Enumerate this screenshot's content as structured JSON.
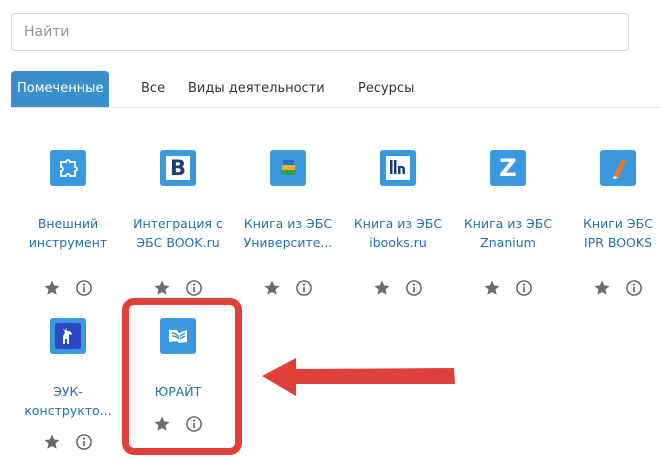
{
  "search": {
    "placeholder": "Найти"
  },
  "tabs": [
    {
      "label": "Помеченные"
    },
    {
      "label": "Все"
    },
    {
      "label": "Виды деятельности"
    },
    {
      "label": "Ресурсы"
    }
  ],
  "tiles": [
    {
      "line1": "Внешний",
      "line2": "инструмент",
      "icon": "puzzle-icon"
    },
    {
      "line1": "Интеграция с",
      "line2": "ЭБС BOOK.ru",
      "icon": "letter-b-icon"
    },
    {
      "line1": "Книга из ЭБС",
      "line2": "Университе...",
      "icon": "books-stack-icon"
    },
    {
      "line1": "Книга из ЭБС",
      "line2": "ibooks.ru",
      "icon": "ibooks-icon"
    },
    {
      "line1": "Книга из ЭБС",
      "line2": "Znanium",
      "icon": "letter-z-icon"
    },
    {
      "line1": "Книги ЭБС",
      "line2": "IPR BOOKS",
      "icon": "pen-icon"
    },
    {
      "line1": "ЭУК-",
      "line2": "конструкто...",
      "icon": "deer-icon"
    },
    {
      "line1": "ЮРАЙТ",
      "line2": "",
      "icon": "open-book-icon"
    }
  ],
  "colors": {
    "accent": "#3a8fca",
    "icon_bg": "#3a98de",
    "highlight": "#e0403a"
  }
}
